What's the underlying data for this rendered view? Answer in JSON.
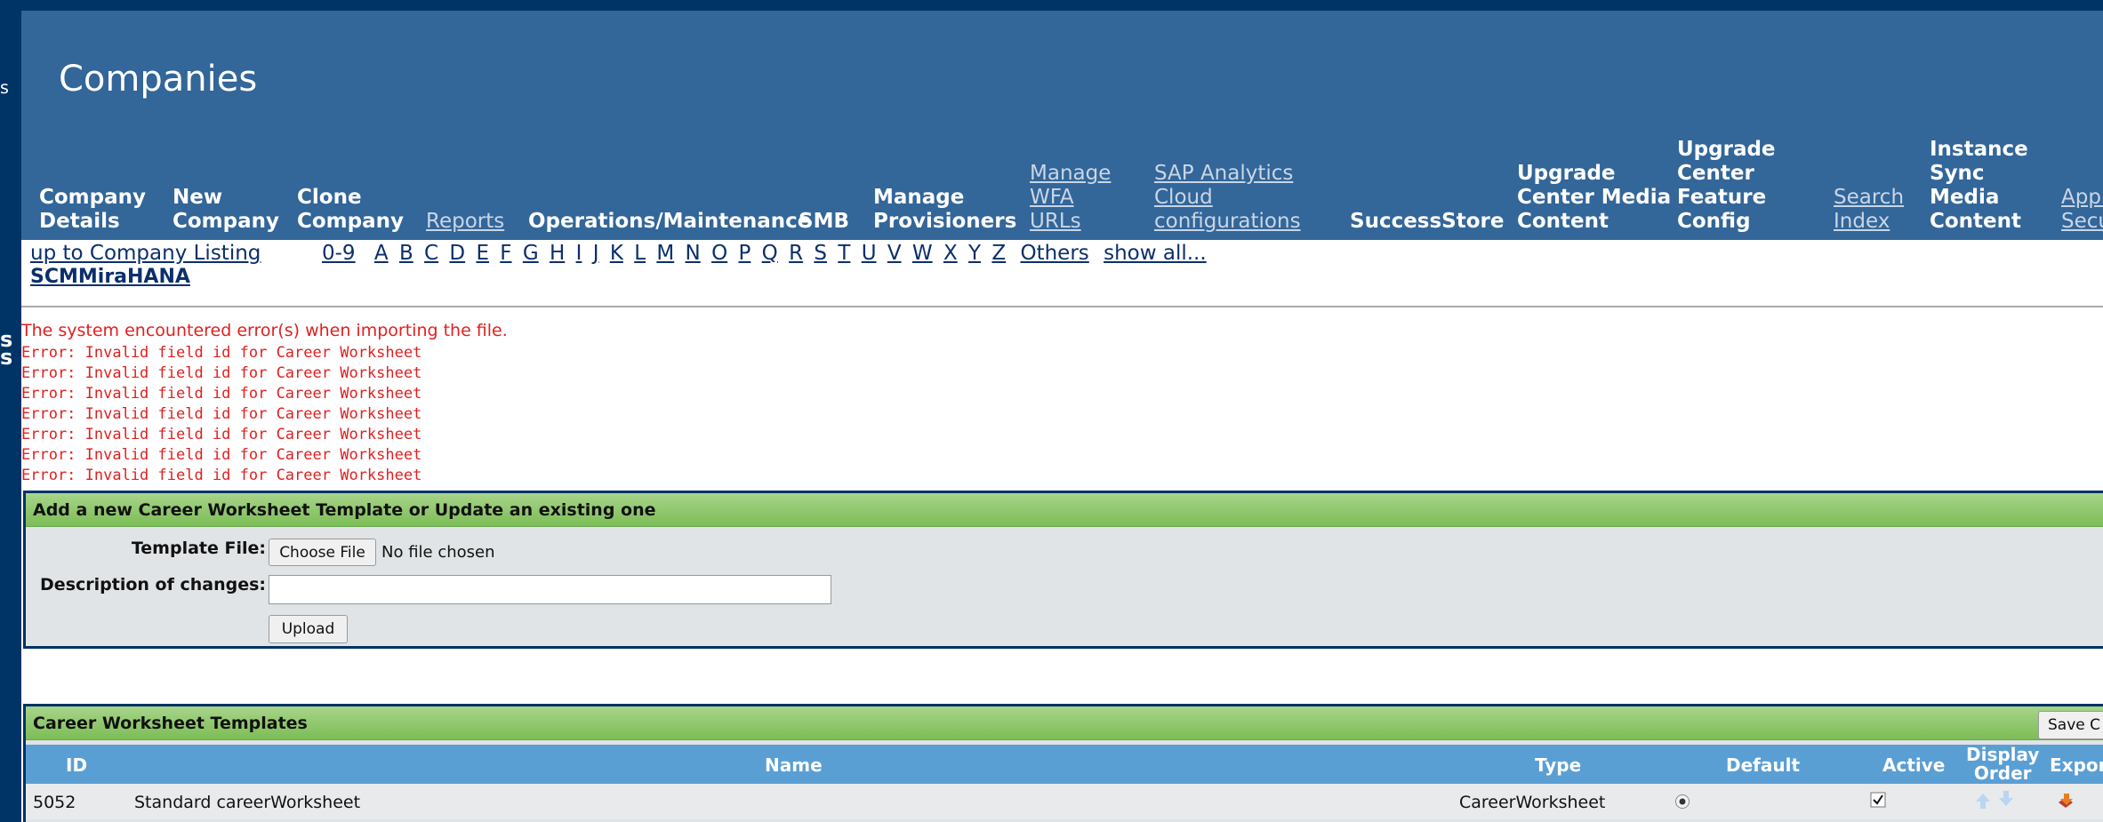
{
  "left_strip": {
    "fragment_1": "s",
    "fragment_2": "s",
    "fragment_3": "s"
  },
  "page": {
    "title": "Companies"
  },
  "nav": {
    "company_details": [
      "Company",
      "Details"
    ],
    "new_company": [
      "New",
      "Company"
    ],
    "clone_company": [
      "Clone",
      "Company"
    ],
    "reports": "Reports",
    "operations": "Operations/Maintenance",
    "smb": "SMB",
    "manage_provisioners": [
      "Manage",
      "Provisioners"
    ],
    "manage_wfa_urls": [
      "Manage",
      "WFA",
      "URLs"
    ],
    "sap_analytics": [
      "SAP Analytics",
      "Cloud",
      "configurations"
    ],
    "successstore": "SuccessStore",
    "upgrade_center_media": [
      "Upgrade",
      "Center Media",
      "Content"
    ],
    "upgrade_center_feature": [
      "Upgrade",
      "Center",
      "Feature",
      "Config"
    ],
    "search_index": [
      "Search",
      "Index"
    ],
    "instance_sync": [
      "Instance",
      "Sync",
      "Media",
      "Content"
    ],
    "app_security": [
      "Appl",
      "Secu"
    ]
  },
  "breadcrumb": {
    "up_link": "up to Company Listing",
    "company": "SCMMiraHANA"
  },
  "alphabet": [
    "0-9",
    "A",
    "B",
    "C",
    "D",
    "E",
    "F",
    "G",
    "H",
    "I",
    "J",
    "K",
    "L",
    "M",
    "N",
    "O",
    "P",
    "Q",
    "R",
    "S",
    "T",
    "U",
    "V",
    "W",
    "X",
    "Y",
    "Z"
  ],
  "alphabet_extra": {
    "others": "Others",
    "show_all": "show all..."
  },
  "errors": {
    "summary": "The system encountered error(s) when importing the file.",
    "lines": [
      "Error: Invalid field id for Career Worksheet",
      "Error: Invalid field id for Career Worksheet",
      "Error: Invalid field id for Career Worksheet",
      "Error: Invalid field id for Career Worksheet",
      "Error: Invalid field id for Career Worksheet",
      "Error: Invalid field id for Career Worksheet",
      "Error: Invalid field id for Career Worksheet"
    ]
  },
  "upload_panel": {
    "title": "Add a new Career Worksheet Template or Update an existing one",
    "template_file_label": "Template File:",
    "choose_file": "Choose File",
    "no_file": "No file chosen",
    "description_label": "Description of changes:",
    "description_value": "",
    "upload_button": "Upload"
  },
  "templates_panel": {
    "title": "Career Worksheet Templates",
    "save_button": "Save C",
    "columns": {
      "id": "ID",
      "name": "Name",
      "type": "Type",
      "default": "Default",
      "active": "Active",
      "display_order": [
        "Display",
        "Order"
      ],
      "export": "Expor"
    },
    "rows": [
      {
        "id": "5052",
        "name": "Standard careerWorksheet",
        "type": "CareerWorksheet",
        "default": true,
        "active": true
      }
    ]
  },
  "colors": {
    "header_bg": "#336699",
    "strip_bg": "#003366",
    "green_bar": "#7cbd56",
    "col_header": "#5a9fd4",
    "error": "#e02020",
    "link": "#0b2f6b"
  },
  "icons": {
    "radio": "radio-selected-icon",
    "checkbox": "checkbox-checked-icon",
    "up": "arrow-up-icon",
    "down": "arrow-down-icon",
    "export": "export-icon"
  }
}
